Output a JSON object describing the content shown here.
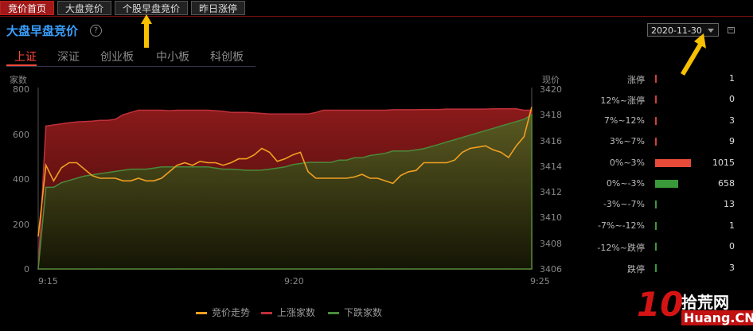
{
  "tabs": [
    {
      "label": "竞价首页",
      "active": true
    },
    {
      "label": "大盘竞价",
      "active": false
    },
    {
      "label": "个股早盘竞价",
      "active": false
    },
    {
      "label": "昨日涨停",
      "active": false
    }
  ],
  "title": "大盘早盘竞价",
  "help": "?",
  "date": "2020-11-30",
  "subtabs": [
    {
      "label": "上证",
      "active": true
    },
    {
      "label": "深证",
      "active": false
    },
    {
      "label": "创业板",
      "active": false
    },
    {
      "label": "中小板",
      "active": false
    },
    {
      "label": "科创板",
      "active": false
    }
  ],
  "colors": {
    "price": "#f0a020",
    "up": "#c0303a",
    "down": "#4a8a3a",
    "accent": "#3aa0ff",
    "active_tab": "#a01818"
  },
  "chart_data": {
    "type": "area",
    "xlabel": "",
    "ylabel_left": "家数",
    "ylabel_right": "现价",
    "x_ticks": [
      "9:15",
      "9:20",
      "9:25"
    ],
    "ylim_left": [
      0,
      800
    ],
    "ylim_right": [
      3406,
      3420
    ],
    "yticks_left": [
      0,
      200,
      400,
      600,
      800
    ],
    "yticks_right": [
      3406,
      3408,
      3410,
      3412,
      3414,
      3416,
      3418,
      3420
    ],
    "series": [
      {
        "name": "上涨家数",
        "axis": "left",
        "values": [
          0,
          630,
          635,
          640,
          645,
          648,
          650,
          652,
          655,
          655,
          660,
          680,
          690,
          700,
          700,
          700,
          700,
          698,
          700,
          700,
          700,
          700,
          700,
          698,
          695,
          690,
          690,
          690,
          688,
          686,
          683,
          683,
          683,
          683,
          683,
          683,
          690,
          700,
          700,
          700,
          700,
          700,
          700,
          700,
          700,
          700,
          702,
          702,
          702,
          702,
          703,
          703,
          703,
          705,
          705,
          705,
          705,
          705,
          705,
          706,
          706,
          706,
          706,
          700,
          700
        ]
      },
      {
        "name": "下跌家数",
        "axis": "left",
        "values": [
          0,
          360,
          360,
          380,
          390,
          400,
          410,
          415,
          420,
          425,
          430,
          435,
          440,
          440,
          440,
          445,
          450,
          450,
          450,
          450,
          450,
          450,
          450,
          445,
          440,
          440,
          438,
          435,
          435,
          436,
          440,
          445,
          450,
          460,
          465,
          470,
          470,
          470,
          470,
          480,
          480,
          490,
          490,
          500,
          505,
          510,
          520,
          520,
          520,
          525,
          530,
          540,
          550,
          560,
          570,
          580,
          590,
          600,
          610,
          620,
          630,
          640,
          650,
          660,
          680
        ]
      },
      {
        "name": "竞价走势",
        "axis": "right",
        "values": [
          3408.5,
          3414.0,
          3412.8,
          3413.8,
          3414.2,
          3414.2,
          3413.7,
          3413.2,
          3413.0,
          3413.0,
          3413.0,
          3412.8,
          3412.8,
          3413.0,
          3412.8,
          3412.8,
          3413.0,
          3413.5,
          3414.0,
          3414.2,
          3414.0,
          3414.3,
          3414.2,
          3414.2,
          3414.0,
          3414.2,
          3414.5,
          3414.5,
          3414.8,
          3415.3,
          3415.0,
          3414.3,
          3414.5,
          3414.8,
          3415.0,
          3413.5,
          3413.0,
          3413.0,
          3413.0,
          3413.0,
          3413.0,
          3413.1,
          3413.3,
          3413.0,
          3413.0,
          3412.8,
          3412.6,
          3413.2,
          3413.5,
          3413.6,
          3414.2,
          3414.2,
          3414.2,
          3414.2,
          3414.4,
          3415.0,
          3415.3,
          3415.4,
          3415.5,
          3415.2,
          3415.0,
          3414.6,
          3415.5,
          3416.2,
          3418.5
        ]
      }
    ]
  },
  "legend": [
    {
      "label": "竞价走势",
      "color": "#f0a020"
    },
    {
      "label": "上涨家数",
      "color": "#c0303a"
    },
    {
      "label": "下跌家数",
      "color": "#4a8a3a"
    }
  ],
  "distribution": [
    {
      "label": "涨停",
      "count": 1,
      "color": "#d04040"
    },
    {
      "label": "12%~涨停",
      "count": 0,
      "color": "#d04040"
    },
    {
      "label": "7%~12%",
      "count": 3,
      "color": "#d04040"
    },
    {
      "label": "3%~7%",
      "count": 9,
      "color": "#d04040"
    },
    {
      "label": "0%~3%",
      "count": 1015,
      "color": "#e84a3a"
    },
    {
      "label": "0%~-3%",
      "count": 658,
      "color": "#3a9a3a"
    },
    {
      "label": "-3%~-7%",
      "count": 13,
      "color": "#3a9a3a"
    },
    {
      "label": "-7%~-12%",
      "count": 1,
      "color": "#3a9a3a"
    },
    {
      "label": "-12%~跌停",
      "count": 0,
      "color": "#3a9a3a"
    },
    {
      "label": "跌停",
      "count": 3,
      "color": "#3a9a3a"
    }
  ],
  "watermark": {
    "number": "10",
    "name": "拾荒网",
    "domain": "Huang.CN"
  }
}
